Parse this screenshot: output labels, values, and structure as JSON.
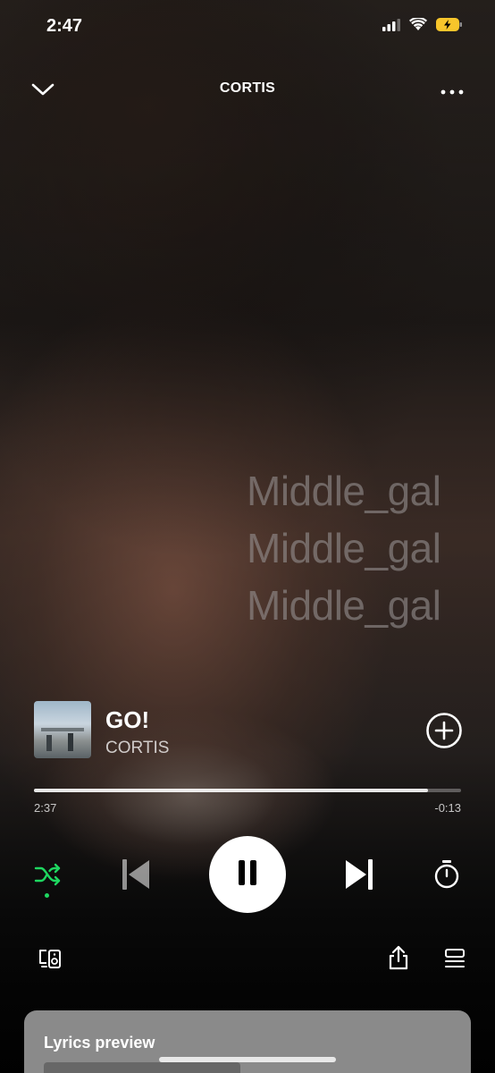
{
  "status_bar": {
    "time": "2:47",
    "icons": [
      "cellular-signal-icon",
      "wifi-icon",
      "battery-charging-icon"
    ]
  },
  "header": {
    "title": "CORTIS",
    "left_icon": "chevron-down-icon",
    "right_icon": "more-options-icon"
  },
  "watermark": {
    "lines": [
      "Middle_gal",
      "Middle_gal",
      "Middle_gal"
    ]
  },
  "track": {
    "title": "GO!",
    "artist": "CORTIS",
    "add_icon": "add-circle-icon"
  },
  "playback": {
    "elapsed": "2:37",
    "remaining": "-0:13",
    "progress_fraction": 0.923
  },
  "controls": {
    "shuffle_icon": "shuffle-icon",
    "previous_icon": "skip-previous-icon",
    "play_pause_icon": "pause-icon",
    "next_icon": "skip-next-icon",
    "timer_icon": "sleep-timer-icon"
  },
  "bottom_bar": {
    "devices_icon": "connect-device-icon",
    "share_icon": "share-icon",
    "queue_icon": "queue-icon"
  },
  "lyrics": {
    "title": "Lyrics preview"
  },
  "colors": {
    "accent": "#1ed760",
    "lyrics_card": "#8a8a8a"
  }
}
